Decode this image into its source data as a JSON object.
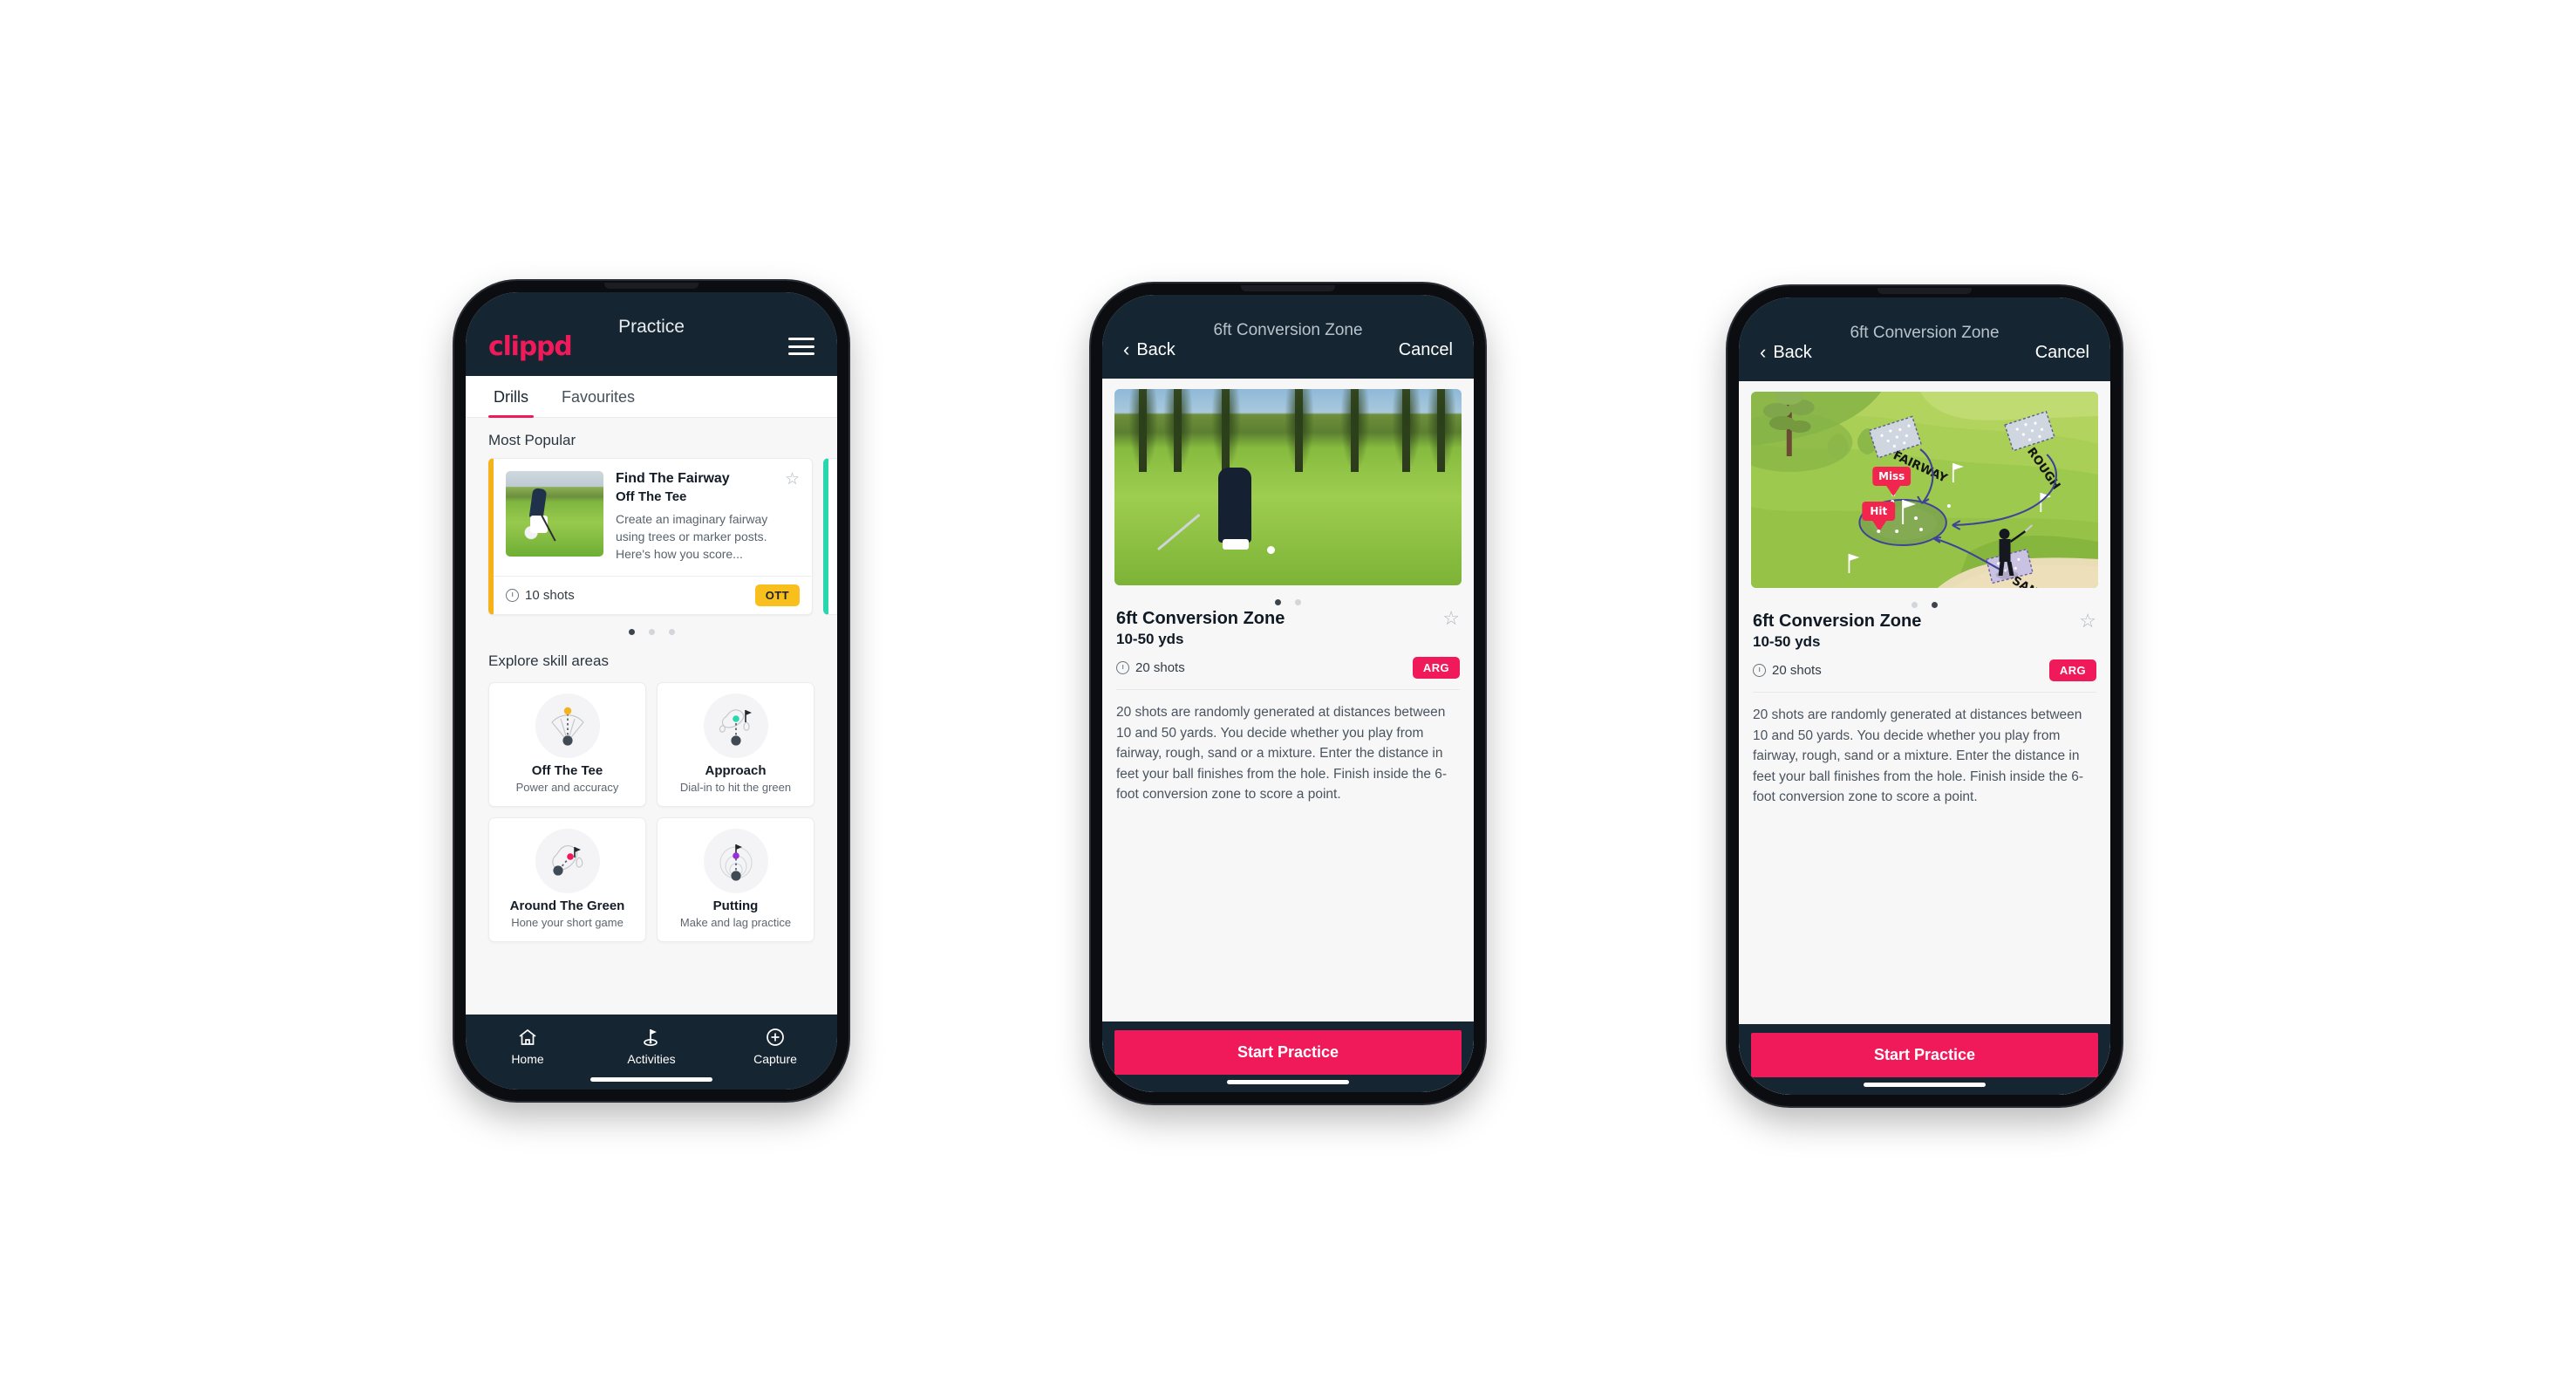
{
  "brand": {
    "name": "clippd",
    "accent": "#f01a5a",
    "dark": "#152532",
    "ott_color": "#f9bf1c",
    "arg_color": "#f01a5a",
    "teal": "#2ad6ae"
  },
  "phone1": {
    "appbar": {
      "logo": "clippd",
      "title": "Practice",
      "menu_icon": "hamburger-icon"
    },
    "tabs": [
      {
        "label": "Drills",
        "active": true
      },
      {
        "label": "Favourites",
        "active": false
      }
    ],
    "sections": {
      "popular_label": "Most Popular",
      "explore_label": "Explore skill areas"
    },
    "popular_card": {
      "title": "Find The Fairway",
      "subtitle": "Off The Tee",
      "description": "Create an imaginary fairway using trees or marker posts. Here's how you score...",
      "shots": "10 shots",
      "badge": "OTT",
      "favourite_icon": "star-outline-icon",
      "clock_icon": "clock-icon",
      "accent": "#f5b21a"
    },
    "carousel_dots": {
      "count": 3,
      "active_index": 0
    },
    "skill_areas": [
      {
        "name": "Off The Tee",
        "desc": "Power and accuracy",
        "icon": "off-the-tee-icon",
        "dot_color": "#f5b21a"
      },
      {
        "name": "Approach",
        "desc": "Dial-in to hit the green",
        "icon": "approach-icon",
        "dot_color": "#2ad6ae"
      },
      {
        "name": "Around The Green",
        "desc": "Hone your short game",
        "icon": "around-the-green-icon",
        "dot_color": "#f01a5a"
      },
      {
        "name": "Putting",
        "desc": "Make and lag practice",
        "icon": "putting-icon",
        "dot_color": "#9b2fd6"
      }
    ],
    "tabbar": [
      {
        "label": "Home",
        "icon": "home-icon",
        "active": false
      },
      {
        "label": "Activities",
        "icon": "golf-flag-icon",
        "active": true
      },
      {
        "label": "Capture",
        "icon": "plus-circle-icon",
        "active": false
      }
    ]
  },
  "phone2": {
    "navbar": {
      "back": "Back",
      "back_icon": "chevron-left-icon",
      "title": "6ft Conversion Zone",
      "cancel": "Cancel"
    },
    "hero": "golfer-putting-photo",
    "dots": {
      "count": 2,
      "active_index": 0
    },
    "detail": {
      "title": "6ft Conversion Zone",
      "subtitle": "10-50 yds",
      "shots": "20 shots",
      "badge": "ARG",
      "favourite_icon": "star-outline-icon",
      "clock_icon": "clock-icon",
      "description": "20 shots are randomly generated at distances between 10 and 50 yards. You decide whether you play from fairway, rough, sand or a mixture. Enter the distance in feet your ball finishes from the hole. Finish inside the 6-foot conversion zone to score a point."
    },
    "cta": "Start Practice"
  },
  "phone3": {
    "navbar": {
      "back": "Back",
      "back_icon": "chevron-left-icon",
      "title": "6ft Conversion Zone",
      "cancel": "Cancel"
    },
    "hero": "course-map-illustration",
    "map_labels": {
      "fairway": "FAIRWAY",
      "rough": "ROUGH",
      "sand": "SAND",
      "miss": "Miss",
      "hit": "Hit"
    },
    "dots": {
      "count": 2,
      "active_index": 1
    },
    "detail": {
      "title": "6ft Conversion Zone",
      "subtitle": "10-50 yds",
      "shots": "20 shots",
      "badge": "ARG",
      "favourite_icon": "star-outline-icon",
      "clock_icon": "clock-icon",
      "description": "20 shots are randomly generated at distances between 10 and 50 yards. You decide whether you play from fairway, rough, sand or a mixture. Enter the distance in feet your ball finishes from the hole. Finish inside the 6-foot conversion zone to score a point."
    },
    "cta": "Start Practice"
  }
}
